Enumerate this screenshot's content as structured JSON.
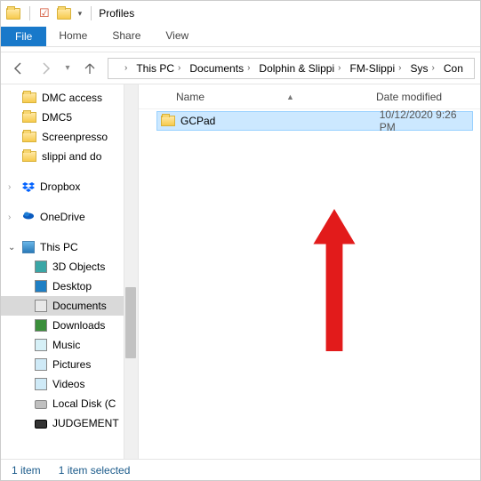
{
  "window": {
    "title": "Profiles"
  },
  "tabs": {
    "file": "File",
    "home": "Home",
    "share": "Share",
    "view": "View"
  },
  "breadcrumbs": [
    "This PC",
    "Documents",
    "Dolphin & Slippi",
    "FM-Slippi",
    "Sys",
    "Con"
  ],
  "columns": {
    "name": "Name",
    "date": "Date modified"
  },
  "files": [
    {
      "name": "GCPad",
      "date": "10/12/2020 9:26 PM"
    }
  ],
  "sidebar": {
    "quick": [
      {
        "label": "DMC access"
      },
      {
        "label": "DMC5"
      },
      {
        "label": "Screenpresso"
      },
      {
        "label": "slippi and do"
      }
    ],
    "dropbox": "Dropbox",
    "onedrive": "OneDrive",
    "thispc": {
      "label": "This PC",
      "children": [
        {
          "label": "3D Objects",
          "icon": "generic"
        },
        {
          "label": "Desktop",
          "icon": "desktop"
        },
        {
          "label": "Documents",
          "icon": "docs",
          "selected": true
        },
        {
          "label": "Downloads",
          "icon": "downloads"
        },
        {
          "label": "Music",
          "icon": "music"
        },
        {
          "label": "Pictures",
          "icon": "pictures"
        },
        {
          "label": "Videos",
          "icon": "videos"
        },
        {
          "label": "Local Disk (C",
          "icon": "disk"
        },
        {
          "label": "JUDGEMENT",
          "icon": "diskdark"
        }
      ]
    }
  },
  "status": {
    "count": "1 item",
    "selected": "1 item selected"
  }
}
